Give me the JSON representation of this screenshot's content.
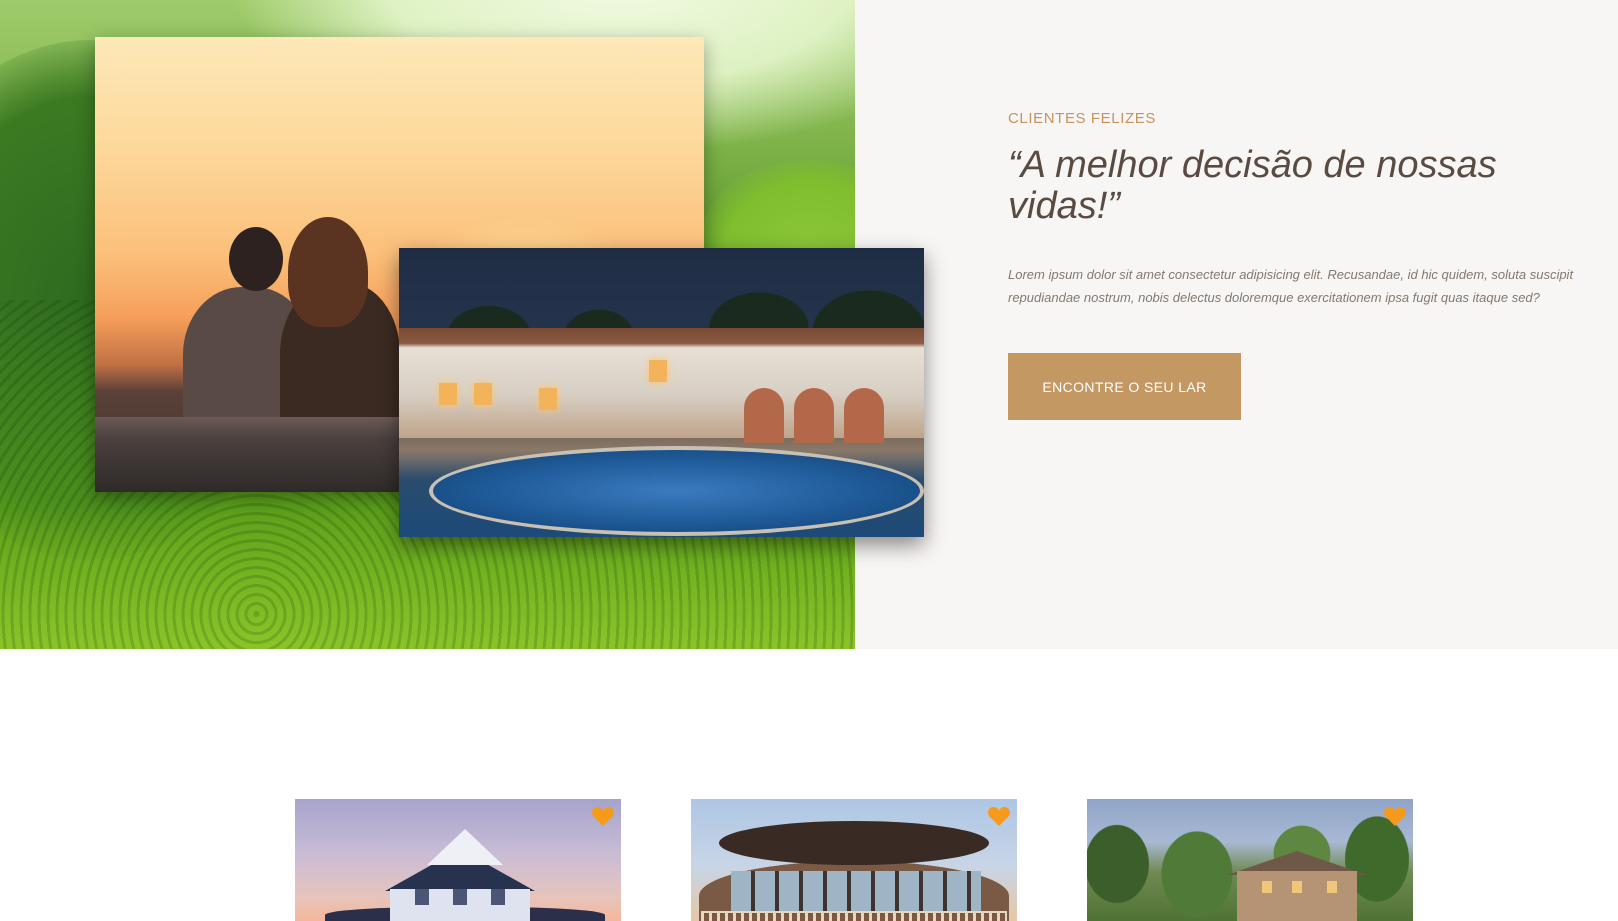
{
  "testimonial": {
    "eyebrow": "CLIENTES FELIZES",
    "headline": "“A melhor decisão de nossas vidas!”",
    "body": "Lorem ipsum dolor sit amet consectetur adipisicing elit. Recusandae, id hic quidem, soluta suscipit repudiandae nostrum, nobis delectus doloremque exercitationem ipsa fugit quas itaque sed?",
    "cta_label": "ENCONTRE O SEU LAR"
  },
  "colors": {
    "accent": "#c39862",
    "eyebrow": "#c4945c",
    "heading": "#5a4b42",
    "body_text": "#857870",
    "section_bg": "#f7f6f4",
    "favorite_heart": "#f59a1a"
  },
  "properties": [
    {
      "icon": "heart-icon",
      "favorite": true
    },
    {
      "icon": "heart-icon",
      "favorite": true
    },
    {
      "icon": "heart-icon",
      "favorite": true
    }
  ]
}
